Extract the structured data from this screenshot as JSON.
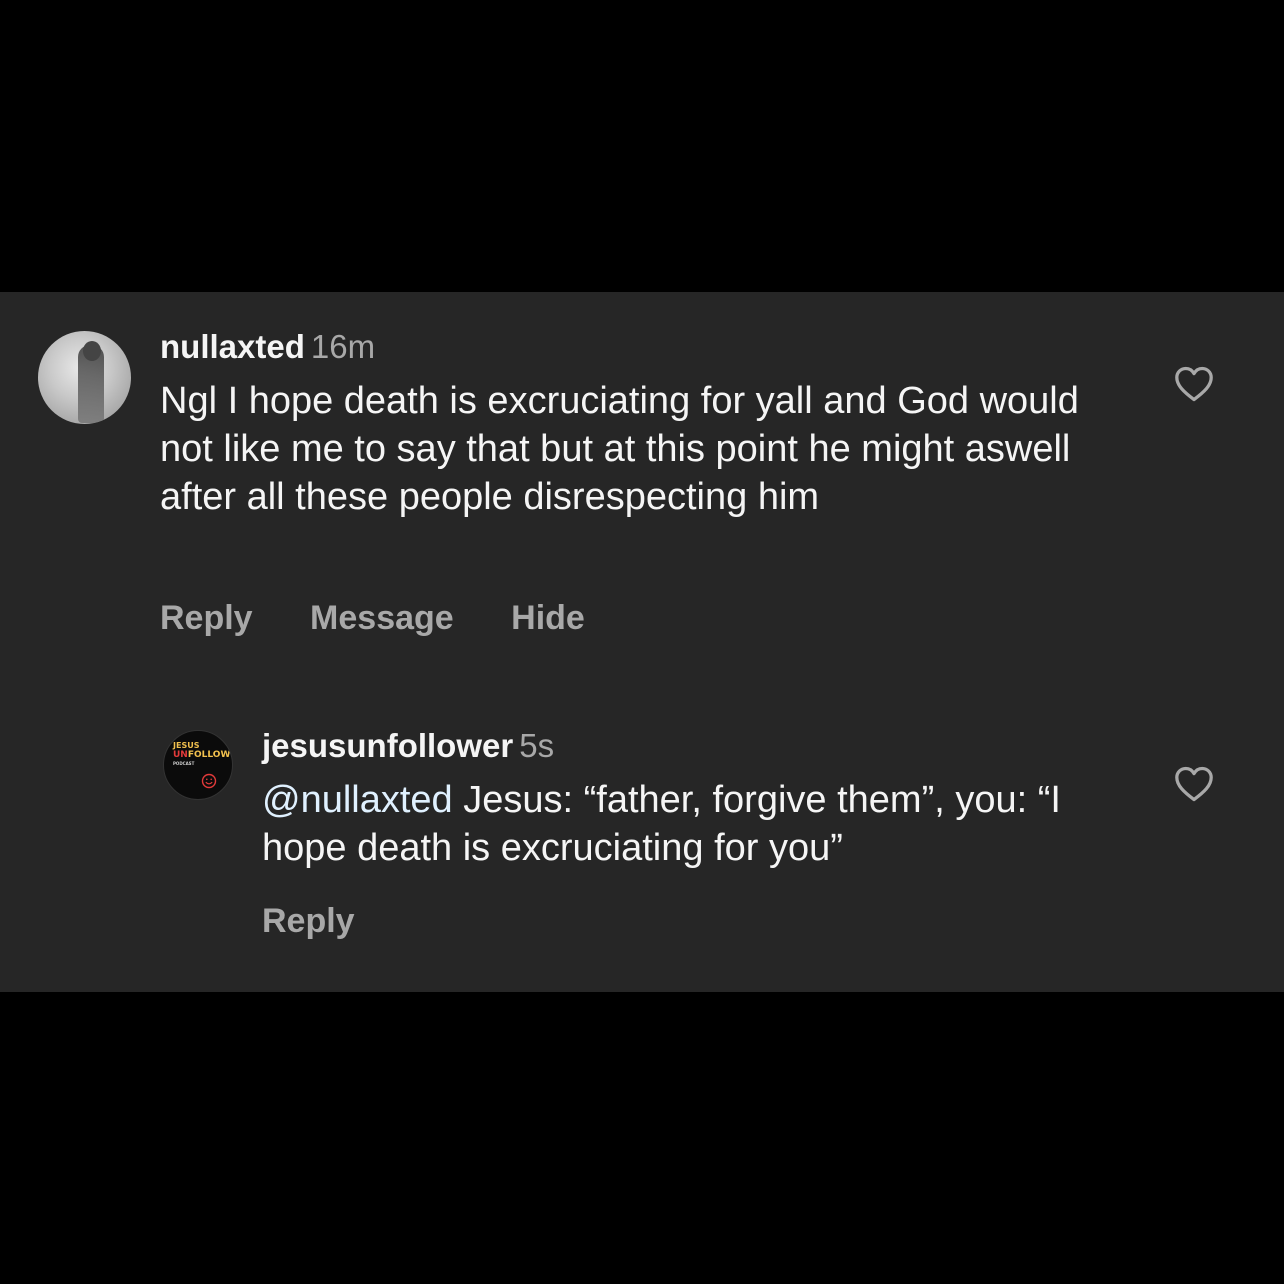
{
  "comments": [
    {
      "username": "nullaxted",
      "time": "16m",
      "text": "Ngl I hope death is excruciating for yall and God would not like me to say that but at this point he might aswell after all these people disrespecting him",
      "actions": {
        "reply": "Reply",
        "message": "Message",
        "hide": "Hide"
      }
    }
  ],
  "reply": {
    "username": "jesusunfollower",
    "time": "5s",
    "mention": "@nullaxted",
    "text": " Jesus: “father, forgive them”, you: “I hope death is excruciating for you”",
    "avatar_logo": {
      "line1": "JESUS",
      "line2_red": "UN",
      "line2_rest": "FOLLOWER",
      "line3": "PODCAST"
    },
    "actions": {
      "reply": "Reply"
    }
  },
  "colors": {
    "background": "#000000",
    "panel": "#262626",
    "primary_text": "#f5f5f5",
    "secondary_text": "#a8a8a8",
    "mention": "#e0f1ff"
  },
  "icons": [
    "heart-icon",
    "smiley-icon"
  ]
}
